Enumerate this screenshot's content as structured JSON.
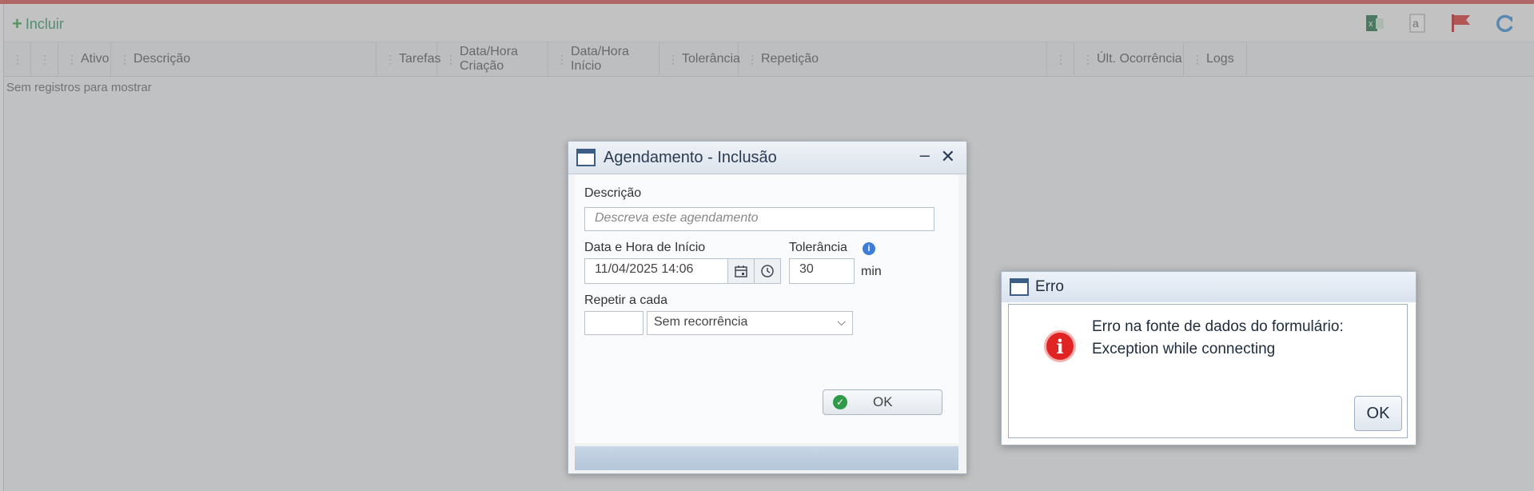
{
  "toolbar": {
    "add_label": "Incluir",
    "icons": [
      "excel-icon",
      "text-export-icon",
      "flag-icon",
      "refresh-icon"
    ],
    "accent_color": "#d9534f"
  },
  "grid": {
    "columns": [
      "",
      "",
      "Ativo",
      "Descrição",
      "Tarefas",
      "Data/Hora Criação",
      "Data/Hora Início",
      "Tolerância",
      "Repetição",
      "",
      "Últ. Ocorrência",
      "Logs"
    ],
    "empty_message": "Sem registros para mostrar"
  },
  "dialog": {
    "title": "Agendamento - Inclusão",
    "descricao_label": "Descrição",
    "descricao_placeholder": "Descreva este agendamento",
    "data_label": "Data e Hora de Início",
    "data_value": "11/04/2025 14:06",
    "tolerancia_label": "Tolerância",
    "tolerancia_value": "30",
    "tolerancia_unit": "min",
    "repetir_label": "Repetir a cada",
    "repetir_value": "",
    "recorrencia_value": "Sem recorrência",
    "ok_label": "OK"
  },
  "error": {
    "title": "Erro",
    "message_line1": "Erro na fonte de dados do formulário:",
    "message_line2": "Exception while connecting",
    "ok_label": "OK"
  }
}
